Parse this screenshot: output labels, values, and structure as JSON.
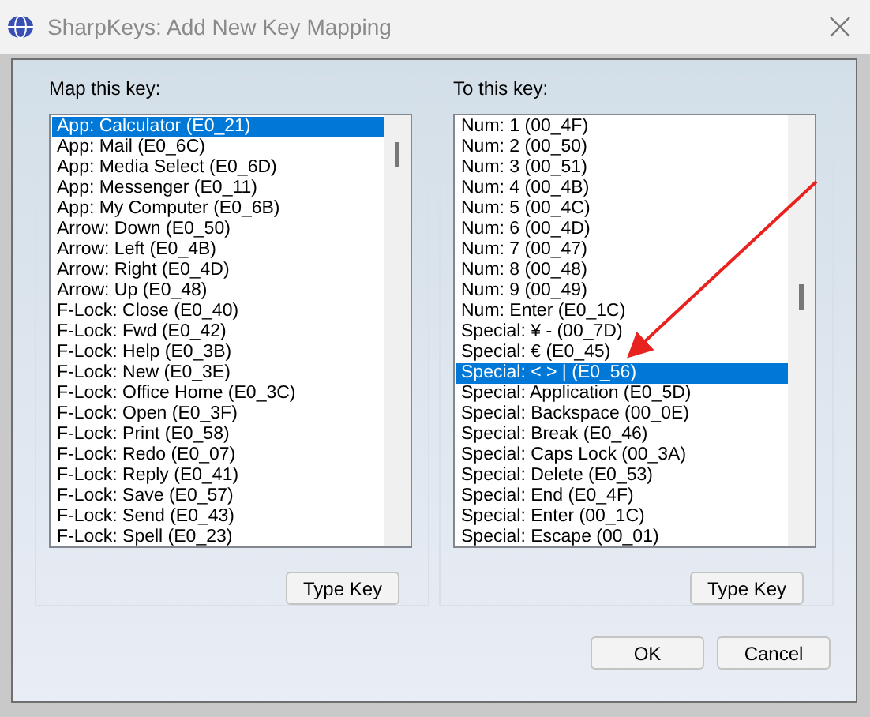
{
  "window": {
    "title": "SharpKeys: Add New Key Mapping"
  },
  "from_group": {
    "label": "Map this key:",
    "button": "Type Key",
    "items": [
      {
        "text": "App: Calculator (E0_21)",
        "selected": true
      },
      {
        "text": "App: Mail (E0_6C)",
        "selected": false
      },
      {
        "text": "App: Media Select (E0_6D)",
        "selected": false
      },
      {
        "text": "App: Messenger (E0_11)",
        "selected": false
      },
      {
        "text": "App: My Computer (E0_6B)",
        "selected": false
      },
      {
        "text": "Arrow: Down (E0_50)",
        "selected": false
      },
      {
        "text": "Arrow: Left (E0_4B)",
        "selected": false
      },
      {
        "text": "Arrow: Right (E0_4D)",
        "selected": false
      },
      {
        "text": "Arrow: Up (E0_48)",
        "selected": false
      },
      {
        "text": "F-Lock: Close (E0_40)",
        "selected": false
      },
      {
        "text": "F-Lock: Fwd (E0_42)",
        "selected": false
      },
      {
        "text": "F-Lock: Help (E0_3B)",
        "selected": false
      },
      {
        "text": "F-Lock: New (E0_3E)",
        "selected": false
      },
      {
        "text": "F-Lock: Office Home (E0_3C)",
        "selected": false
      },
      {
        "text": "F-Lock: Open (E0_3F)",
        "selected": false
      },
      {
        "text": "F-Lock: Print (E0_58)",
        "selected": false
      },
      {
        "text": "F-Lock: Redo (E0_07)",
        "selected": false
      },
      {
        "text": "F-Lock: Reply (E0_41)",
        "selected": false
      },
      {
        "text": "F-Lock: Save (E0_57)",
        "selected": false
      },
      {
        "text": "F-Lock: Send (E0_43)",
        "selected": false
      },
      {
        "text": "F-Lock: Spell (E0_23)",
        "selected": false
      }
    ]
  },
  "to_group": {
    "label": "To this key:",
    "button": "Type Key",
    "items": [
      {
        "text": "Num: 1 (00_4F)",
        "selected": false
      },
      {
        "text": "Num: 2 (00_50)",
        "selected": false
      },
      {
        "text": "Num: 3 (00_51)",
        "selected": false
      },
      {
        "text": "Num: 4 (00_4B)",
        "selected": false
      },
      {
        "text": "Num: 5 (00_4C)",
        "selected": false
      },
      {
        "text": "Num: 6 (00_4D)",
        "selected": false
      },
      {
        "text": "Num: 7 (00_47)",
        "selected": false
      },
      {
        "text": "Num: 8 (00_48)",
        "selected": false
      },
      {
        "text": "Num: 9 (00_49)",
        "selected": false
      },
      {
        "text": "Num: Enter (E0_1C)",
        "selected": false
      },
      {
        "text": "Special: ¥ - (00_7D)",
        "selected": false
      },
      {
        "text": "Special: € (E0_45)",
        "selected": false
      },
      {
        "text": "Special: < > | (E0_56)",
        "selected": true
      },
      {
        "text": "Special: Application (E0_5D)",
        "selected": false
      },
      {
        "text": "Special: Backspace (00_0E)",
        "selected": false
      },
      {
        "text": "Special: Break (E0_46)",
        "selected": false
      },
      {
        "text": "Special: Caps Lock (00_3A)",
        "selected": false
      },
      {
        "text": "Special: Delete (E0_53)",
        "selected": false
      },
      {
        "text": "Special: End (E0_4F)",
        "selected": false
      },
      {
        "text": "Special: Enter (00_1C)",
        "selected": false
      },
      {
        "text": "Special: Escape (00_01)",
        "selected": false
      }
    ]
  },
  "buttons": [
    "OK",
    "Cancel"
  ]
}
